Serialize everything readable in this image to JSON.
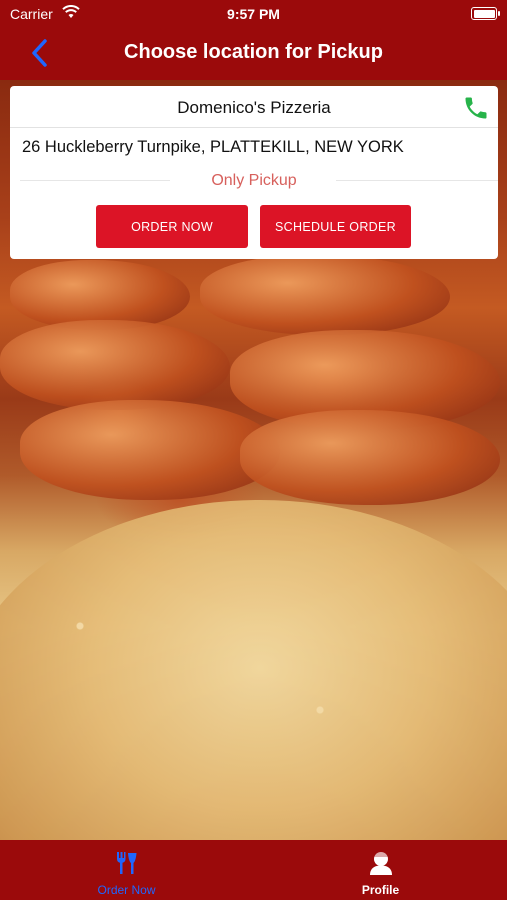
{
  "status_bar": {
    "carrier": "Carrier",
    "time": "9:57 PM"
  },
  "nav": {
    "title": "Choose location for Pickup",
    "back_icon": "chevron-left-icon"
  },
  "location": {
    "name": "Domenico's Pizzeria",
    "address": "26 Huckleberry Turnpike, PLATTEKILL, NEW YORK",
    "mode": "Only Pickup",
    "order_now": "ORDER NOW",
    "schedule_order": "SCHEDULE ORDER",
    "phone_icon": "phone-icon"
  },
  "tabs": [
    {
      "label": "Order Now",
      "icon": "utensils-icon",
      "active": true
    },
    {
      "label": "Profile",
      "icon": "person-icon",
      "active": false
    }
  ],
  "colors": {
    "brand_red": "#9b0a0b",
    "button_red": "#dc1426",
    "active_tab": "#1f66ff",
    "phone_green": "#27b34a",
    "pickup_text": "#d7605c"
  }
}
